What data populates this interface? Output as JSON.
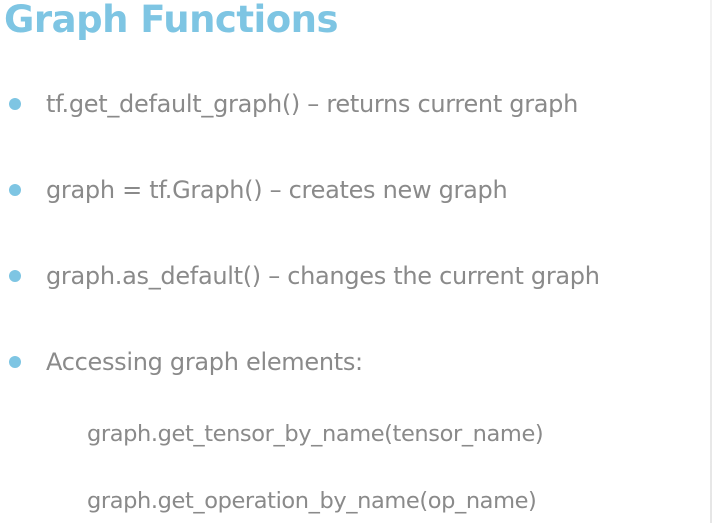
{
  "title": "Graph Functions",
  "bullets": [
    {
      "text": "tf.get_default_graph() – returns current graph"
    },
    {
      "text": "graph = tf.Graph() – creates new graph"
    },
    {
      "text": "graph.as_default() – changes the current graph"
    },
    {
      "text": "Accessing graph elements:"
    }
  ],
  "sub_items": [
    {
      "text": "graph.get_tensor_by_name(tensor_name)"
    },
    {
      "text": "graph.get_operation_by_name(op_name)"
    }
  ],
  "colors": {
    "accent": "#7ec5e3",
    "text": "#8a8a8a",
    "background": "#ffffff"
  }
}
